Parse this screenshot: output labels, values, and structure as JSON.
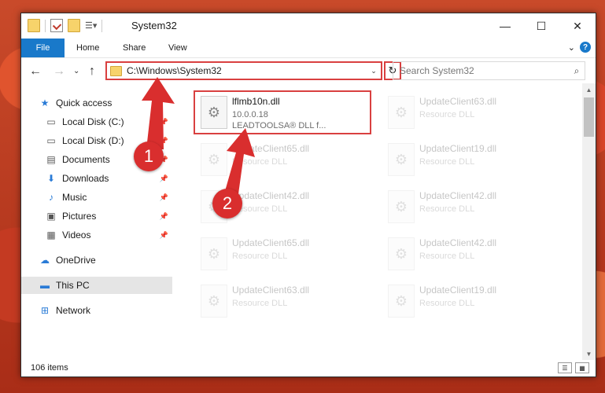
{
  "window": {
    "title": "System32",
    "controls": {
      "minimize": "—",
      "maximize": "☐",
      "close": "✕"
    }
  },
  "ribbon": {
    "tabs": [
      "File",
      "Home",
      "Share",
      "View"
    ],
    "collapse": "⌄",
    "help": "?"
  },
  "nav": {
    "back": "←",
    "forward": "→",
    "recent": "⌄",
    "up": "↑",
    "address": "C:\\Windows\\System32",
    "address_dropdown": "⌄",
    "refresh": "↻",
    "search_placeholder": "Search System32"
  },
  "sidebar": {
    "items": [
      {
        "label": "Quick access",
        "icon": "star-icon",
        "pinned": false
      },
      {
        "label": "Local Disk (C:)",
        "icon": "drive-icon",
        "pinned": true
      },
      {
        "label": "Local Disk (D:)",
        "icon": "drive-icon",
        "pinned": true
      },
      {
        "label": "Documents",
        "icon": "documents-icon",
        "pinned": true
      },
      {
        "label": "Downloads",
        "icon": "downloads-icon",
        "pinned": true
      },
      {
        "label": "Music",
        "icon": "music-icon",
        "pinned": true
      },
      {
        "label": "Pictures",
        "icon": "pictures-icon",
        "pinned": true
      },
      {
        "label": "Videos",
        "icon": "videos-icon",
        "pinned": true
      },
      {
        "label": "OneDrive",
        "icon": "cloud-icon",
        "pinned": false
      },
      {
        "label": "This PC",
        "icon": "computer-icon",
        "pinned": false,
        "selected": true
      },
      {
        "label": "Network",
        "icon": "network-icon",
        "pinned": false
      }
    ]
  },
  "files": [
    {
      "name": "lflmb10n.dll",
      "line2": "10.0.0.18",
      "line3": "LEADTOOLSA® DLL f...",
      "faded": false
    },
    {
      "name": "UpdateClient63.dll",
      "line2": "Resource DLL",
      "faded": true
    },
    {
      "name": "UpdateClient65.dll",
      "line2": "Resource DLL",
      "faded": true
    },
    {
      "name": "UpdateClient19.dll",
      "line2": "Resource DLL",
      "faded": true
    },
    {
      "name": "UpdateClient42.dll",
      "line2": "Resource DLL",
      "faded": true
    },
    {
      "name": "UpdateClient42.dll",
      "line2": "Resource DLL",
      "faded": true
    },
    {
      "name": "UpdateClient65.dll",
      "line2": "Resource DLL",
      "faded": true
    },
    {
      "name": "UpdateClient42.dll",
      "line2": "Resource DLL",
      "faded": true
    },
    {
      "name": "UpdateClient63.dll",
      "line2": "Resource DLL",
      "faded": true
    },
    {
      "name": "UpdateClient19.dll",
      "line2": "Resource DLL",
      "faded": true
    }
  ],
  "status": {
    "count": "106 items"
  },
  "annotations": {
    "step1": "1",
    "step2": "2"
  },
  "colors": {
    "highlight": "#d94040",
    "accent": "#1979ca",
    "badge": "#d92e2e"
  }
}
